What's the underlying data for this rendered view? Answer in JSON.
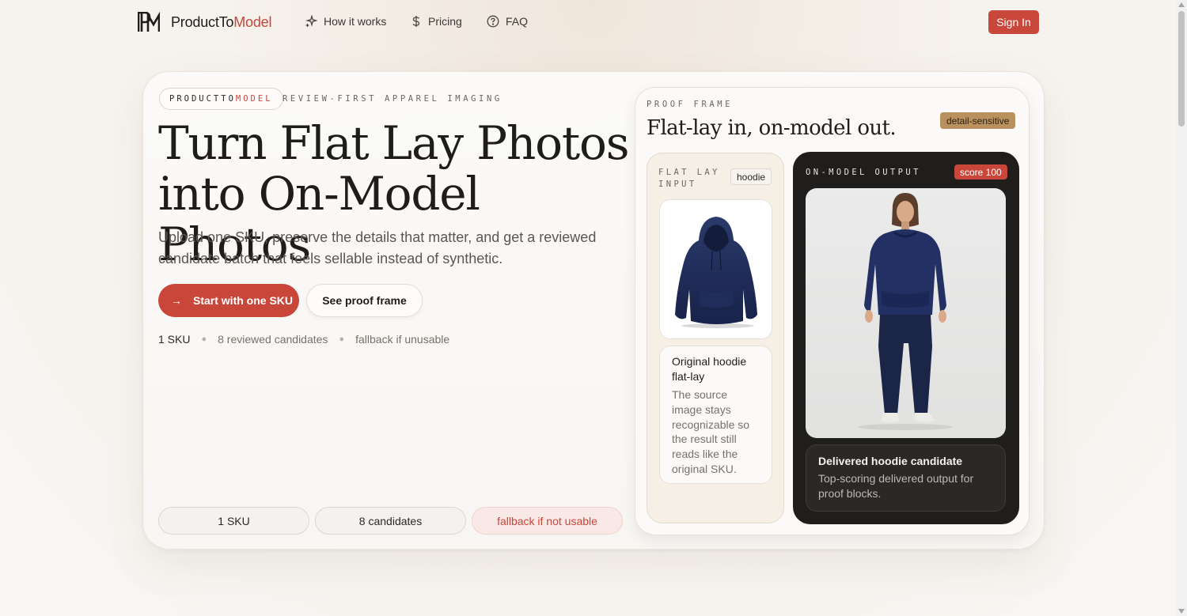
{
  "nav": {
    "brand_prefix": "ProductTo",
    "brand_accent": "Model",
    "links": [
      {
        "label": "How it works",
        "icon": "sparkle-icon"
      },
      {
        "label": "Pricing",
        "icon": "dollar-icon"
      },
      {
        "label": "FAQ",
        "icon": "help-circle-icon"
      }
    ],
    "signin_label": "Sign In"
  },
  "hero": {
    "brand_pill_prefix": "PRODUCTTO",
    "brand_pill_accent": "MODEL",
    "eyebrow": "REVIEW-FIRST APPAREL IMAGING",
    "headline_line1": "Turn Flat Lay Photos",
    "headline_line2": "into On-Model Photos",
    "subtitle": "Upload one SKU, preserve the details that matter, and get a reviewed candidate batch that feels sellable instead of synthetic.",
    "primary_button": "Start with one SKU",
    "secondary_button": "See proof frame",
    "stats": [
      "1 SKU",
      "8 reviewed candidates",
      "fallback if unusable"
    ],
    "chips": [
      "1 SKU",
      "8 candidates",
      "fallback if not usable"
    ]
  },
  "proof": {
    "label": "PROOF FRAME",
    "title": "Flat-lay in, on-model out.",
    "badge": "detail-sensitive",
    "flat": {
      "label": "FLAT LAY INPUT",
      "tag": "hoodie",
      "card_title": "Original hoodie flat-lay",
      "card_desc": "The source image stays recognizable so the result still reads like the original SKU."
    },
    "output": {
      "label": "ON-MODEL OUTPUT",
      "score": "score 100",
      "card_title": "Delivered hoodie candidate",
      "card_desc": "Top-scoring delivered output for proof blocks."
    }
  },
  "colors": {
    "accent": "#c9463a",
    "badge_gold": "#b8915e",
    "dark_panel": "#1f1e1d",
    "garment_navy": "#1e2b55"
  }
}
